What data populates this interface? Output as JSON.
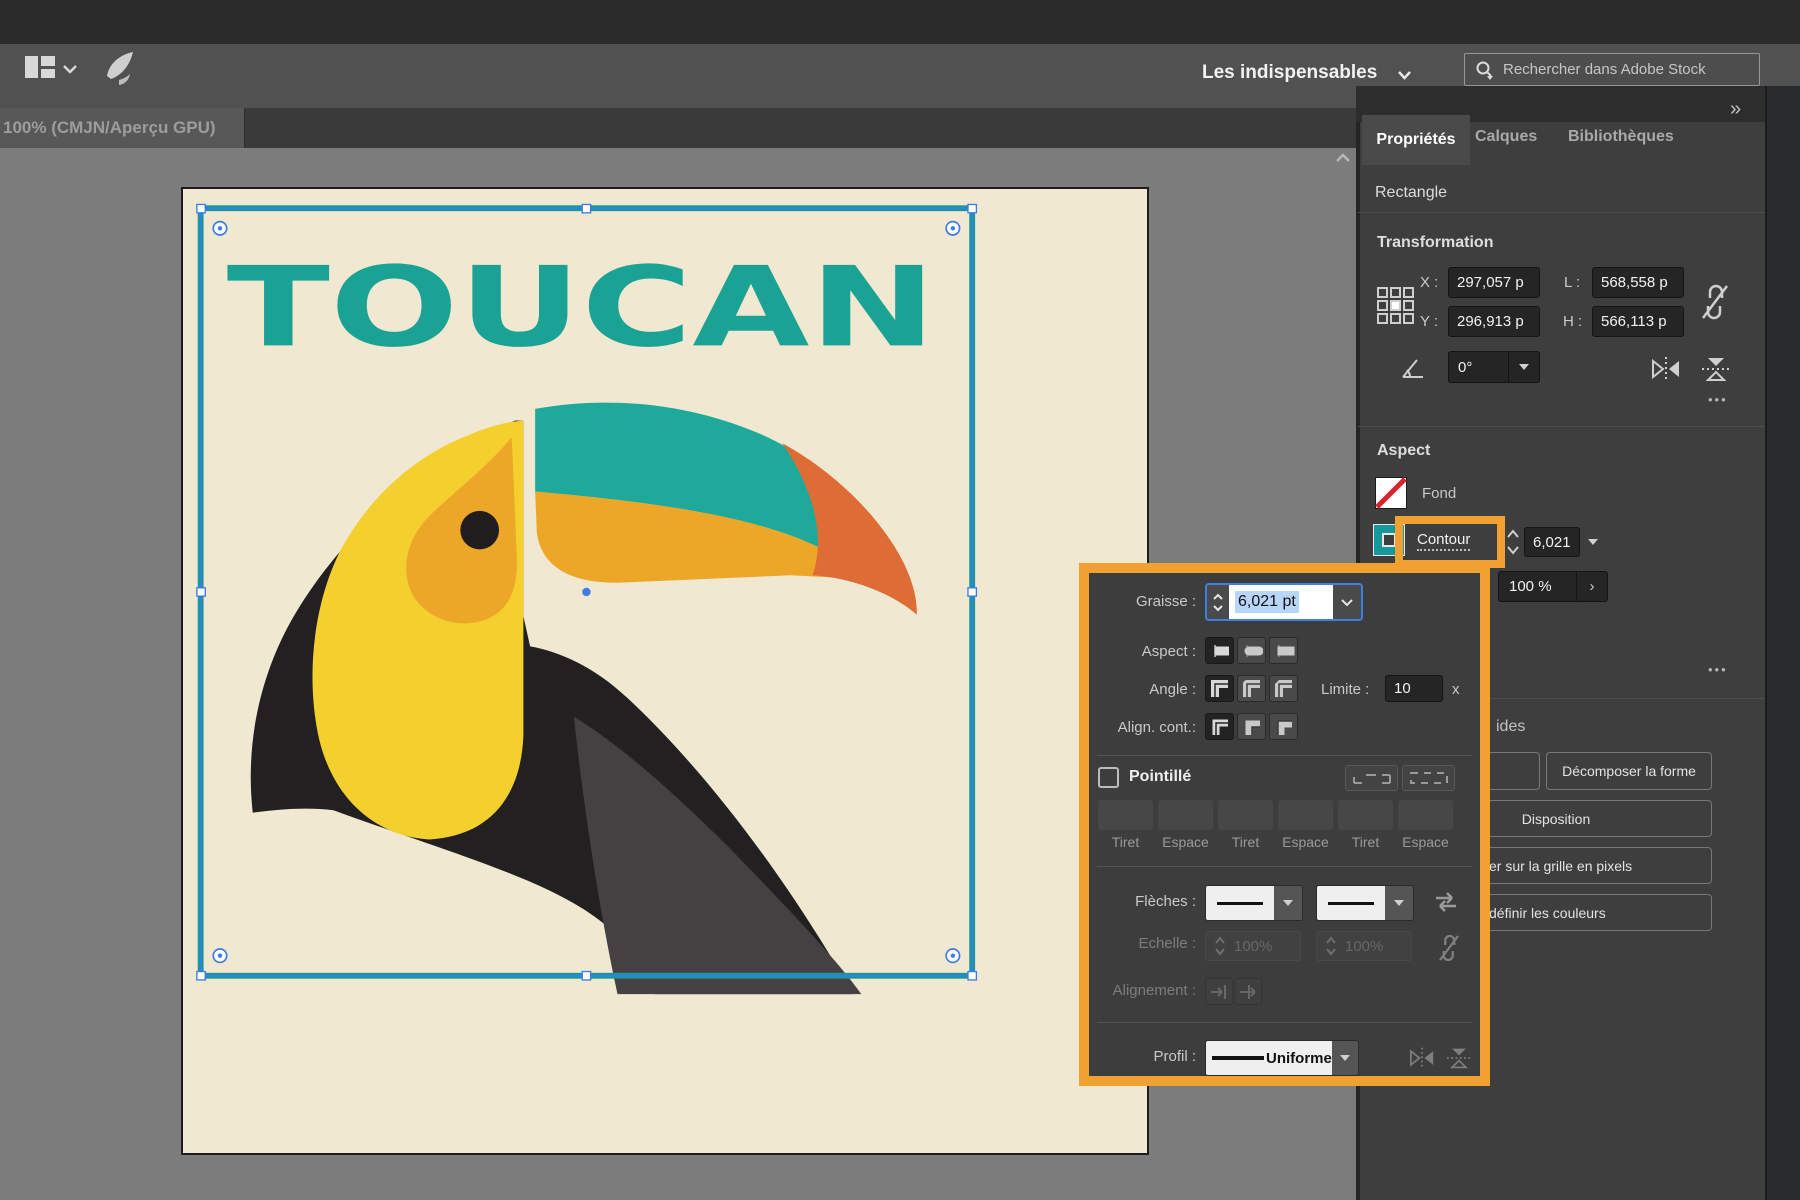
{
  "colors": {
    "accent_orange": "#f0a132",
    "selection_blue": "#3c7ce4",
    "stroke_teal": "#17999b",
    "poster_teal": "#1aa295",
    "cream": "#f0e8d0",
    "panel_bg": "#3e3e3e"
  },
  "topbar": {
    "workspace": "Les indispensables",
    "search_placeholder": "Rechercher dans Adobe Stock"
  },
  "doc_tab": {
    "title": "100% (CMJN/Aperçu GPU)"
  },
  "panel": {
    "tabs": [
      {
        "label": "Propriétés"
      },
      {
        "label": "Calques"
      },
      {
        "label": "Bibliothèques"
      }
    ],
    "object_type": "Rectangle",
    "transform": {
      "title": "Transformation",
      "x_label": "X :",
      "y_label": "Y :",
      "w_label": "L :",
      "h_label": "H :",
      "x": "297,057 p",
      "y": "296,913 p",
      "w": "568,558 p",
      "h": "566,113 p",
      "angle": "0°",
      "more": "•••"
    },
    "aspect": {
      "title": "Aspect",
      "fill_label": "Fond",
      "stroke_label": "Contour",
      "stroke_weight": "6,021",
      "opacity": "100 %",
      "more": "•••"
    },
    "quick_actions": {
      "header_fragment": "ides",
      "button1_fragment": "e",
      "expand_shape": "Décomposer la forme",
      "arrange": "Disposition",
      "pixel_grid_fragment": "er sur la grille en pixels",
      "recolor_fragment": "définir les couleurs"
    }
  },
  "stroke_popup": {
    "weight_label": "Graisse :",
    "weight_value": "6,021 pt",
    "cap_label": "Aspect :",
    "corner_label": "Angle :",
    "miter_label": "Limite :",
    "miter_value": "10",
    "miter_unit": "x",
    "align_label": "Align. cont.:",
    "dashed_label": "Pointillé",
    "dash_fields": [
      "Tiret",
      "Espace",
      "Tiret",
      "Espace",
      "Tiret",
      "Espace"
    ],
    "arrows_label": "Flèches :",
    "scale_label": "Echelle :",
    "scale_left": "100%",
    "scale_right": "100%",
    "align_arrow_label": "Alignement :",
    "profile_label": "Profil :",
    "profile_value": "Uniforme"
  },
  "artwork": {
    "title": "TOUCAN"
  }
}
